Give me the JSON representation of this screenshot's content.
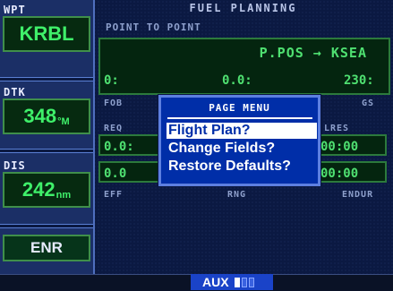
{
  "sidebar": {
    "wpt_label": "WPT",
    "wpt_value": "KRBL",
    "dtk_label": "DTK",
    "dtk_value": "348",
    "dtk_unit": "°M",
    "dis_label": "DIS",
    "dis_value": "242",
    "dis_unit": "nm",
    "mode": "ENR"
  },
  "main": {
    "title": "FUEL PLANNING",
    "subtitle": "POINT TO POINT",
    "route": "P.POS → KSEA",
    "values": [
      "0:",
      "0.0:",
      "230:"
    ],
    "row1_headers": [
      "FOB",
      "GS"
    ],
    "row2_headers": [
      "REQ",
      "LRES"
    ],
    "row2_left": "0.0:",
    "row2_right": "00:00",
    "row3_left": "0.0",
    "row3_right": "00:00",
    "footer_headers": [
      "EFF",
      "RNG",
      "ENDUR"
    ]
  },
  "menu": {
    "title": "PAGE MENU",
    "items": [
      "Flight Plan?",
      "Change Fields?",
      "Restore Defaults?"
    ],
    "selected_index": 0
  },
  "status": {
    "page_group": "AUX",
    "page_indicator": {
      "current": 1,
      "total": 3
    }
  },
  "colors": {
    "display_green": "#4fe071",
    "menu_blue": "#002ea8",
    "background": "#0b1942"
  }
}
